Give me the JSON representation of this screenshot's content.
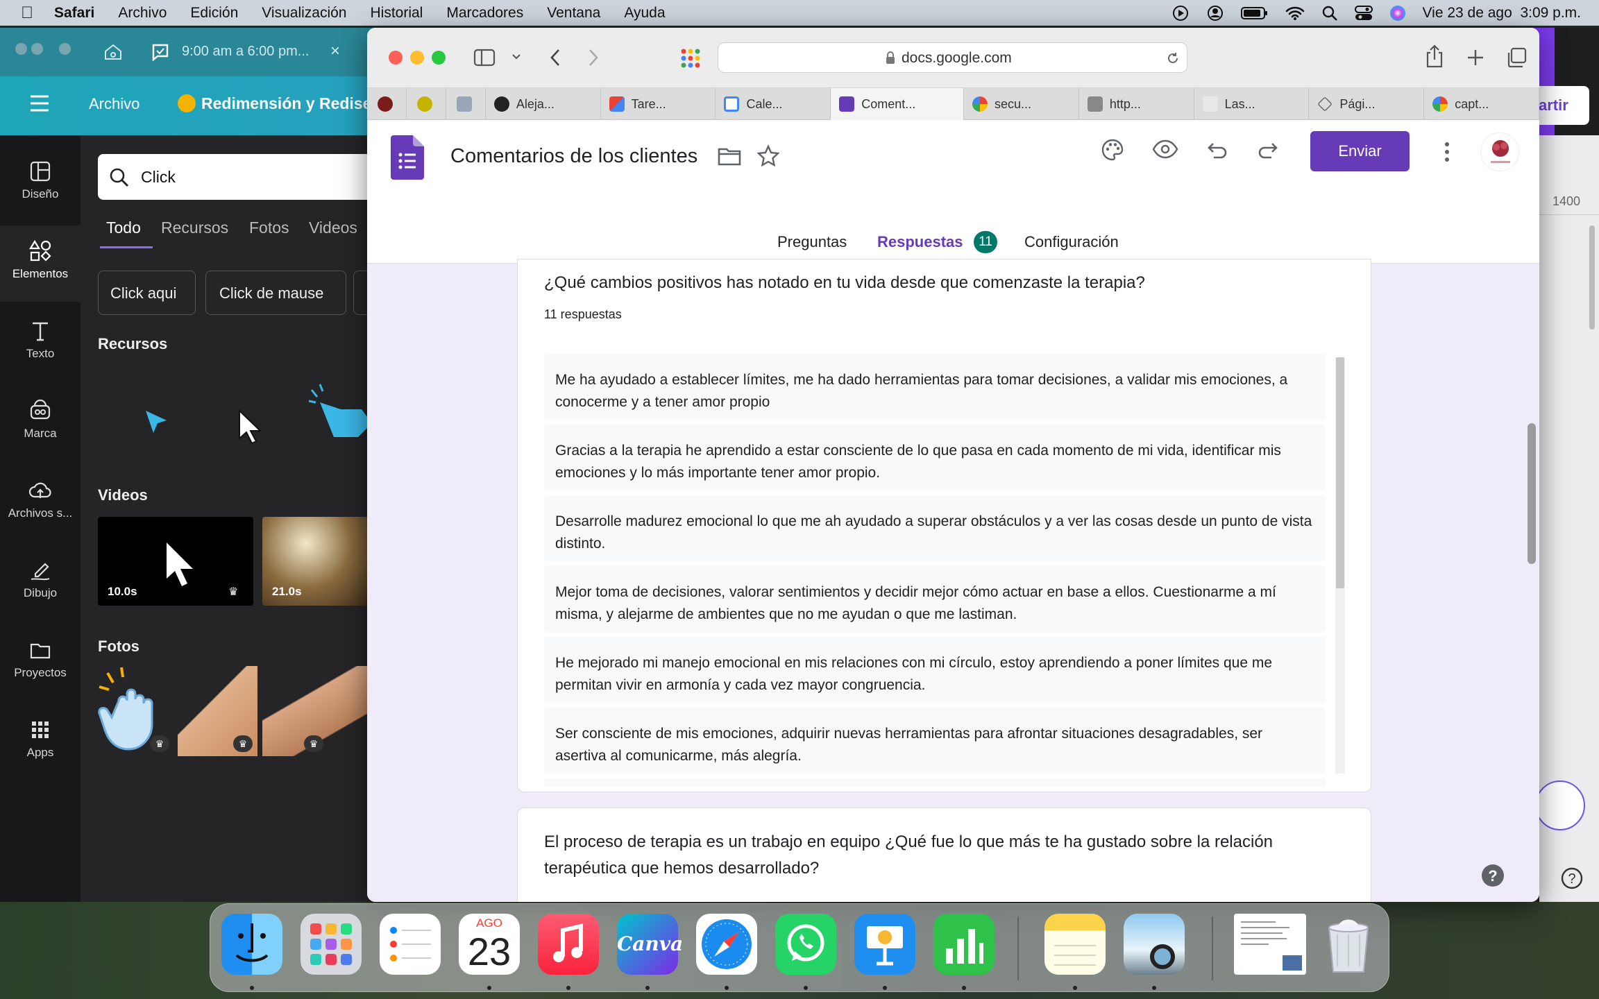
{
  "menubar": {
    "app": "Safari",
    "items": [
      "Archivo",
      "Edición",
      "Visualización",
      "Historial",
      "Marcadores",
      "Ventana",
      "Ayuda"
    ],
    "datetime": "Vie 23 de ago  3:09 p.m."
  },
  "canva": {
    "tab_title": "9:00 am a 6:00 pm...",
    "menu_label": "Archivo",
    "doc_title": "Redimensión y Redise",
    "share_label": "artir",
    "rail": [
      {
        "label": "Diseño"
      },
      {
        "label": "Elementos"
      },
      {
        "label": "Texto"
      },
      {
        "label": "Marca"
      },
      {
        "label": "Archivos s..."
      },
      {
        "label": "Dibujo"
      },
      {
        "label": "Proyectos"
      },
      {
        "label": "Apps"
      }
    ],
    "search_value": "Click",
    "filters": [
      "Todo",
      "Recursos",
      "Fotos",
      "Videos"
    ],
    "chips": [
      "Click aqui",
      "Click de mause"
    ],
    "section_recursos": "Recursos",
    "section_videos": "Videos",
    "section_fotos": "Fotos",
    "video1_duration": "10.0s",
    "video2_duration": "21.0s",
    "ruler_value": "1400"
  },
  "safari": {
    "url": "docs.google.com",
    "tabs": [
      {
        "label": "Aleja..."
      },
      {
        "label": "Tare..."
      },
      {
        "label": "Cale..."
      },
      {
        "label": "Coment..."
      },
      {
        "label": "secu..."
      },
      {
        "label": "http..."
      },
      {
        "label": "Las..."
      },
      {
        "label": "Pági..."
      },
      {
        "label": "capt..."
      }
    ]
  },
  "forms": {
    "title": "Comentarios de los clientes",
    "send_label": "Enviar",
    "tabs": {
      "preguntas": "Preguntas",
      "respuestas": "Respuestas",
      "respuestas_count": "11",
      "configuracion": "Configuración"
    },
    "question1": "¿Qué cambios positivos has notado en tu vida desde que comenzaste la terapia?",
    "question1_count": "11 respuestas",
    "responses": [
      "Me ha ayudado a establecer límites, me ha dado herramientas para tomar decisiones, a validar mis emociones, a conocerme y a tener amor propio",
      "Gracias a la terapia he aprendido a estar consciente de lo que pasa en cada momento de mi vida, identificar mis emociones y lo más importante tener amor propio.",
      "Desarrolle madurez emocional lo que me ah ayudado a superar obstáculos y a ver las cosas desde un punto de vista distinto.",
      "Mejor toma de decisiones, valorar sentimientos y decidir mejor cómo actuar en base a ellos. Cuestionarme a mí misma, y alejarme de ambientes que no me ayudan o que me lastiman.",
      "He mejorado mi manejo emocional en mis relaciones con mi círculo, estoy aprendiendo a poner límites que me permitan vivir en armonía y cada vez mayor congruencia.",
      "Ser consciente de mis emociones, adquirir nuevas herramientas para afrontar situaciones desagradables, ser asertiva al comunicarme, más alegría."
    ],
    "question2": "El proceso de terapia es un trabajo en equipo ¿Qué fue lo que más te ha gustado sobre la relación terapéutica que hemos desarrollado?"
  },
  "dock": {
    "calendar_month": "AGO",
    "calendar_day": "23",
    "canva_label": "Canva"
  },
  "colors": {
    "forms_purple": "#673ab7",
    "canva_teal": "#1ea5b7",
    "accent_teal": "#00796b"
  }
}
